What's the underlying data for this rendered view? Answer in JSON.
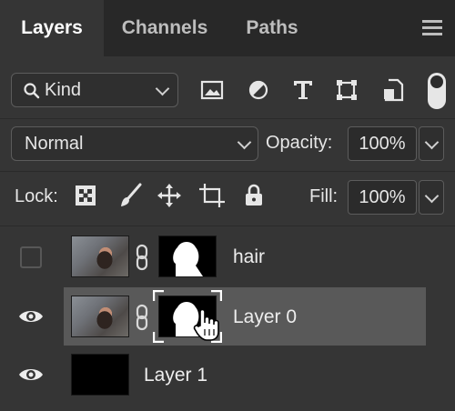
{
  "tabs": [
    {
      "label": "Layers",
      "active": true
    },
    {
      "label": "Channels",
      "active": false
    },
    {
      "label": "Paths",
      "active": false
    }
  ],
  "filter": {
    "kind_label": "Kind",
    "icons": [
      "image-filter-icon",
      "adjustment-filter-icon",
      "type-filter-icon",
      "shape-filter-icon",
      "smart-object-filter-icon"
    ]
  },
  "blend": {
    "mode": "Normal",
    "opacity_label": "Opacity:",
    "opacity_value": "100%"
  },
  "lock": {
    "label": "Lock:",
    "icons": [
      "lock-transparent-pixels-icon",
      "lock-image-pixels-icon",
      "lock-position-icon",
      "lock-artboard-icon",
      "lock-all-icon"
    ],
    "fill_label": "Fill:",
    "fill_value": "100%"
  },
  "layers": [
    {
      "name": "hair",
      "visible": false,
      "selected": false,
      "has_mask": true
    },
    {
      "name": "Layer 0",
      "visible": true,
      "selected": true,
      "has_mask": true
    },
    {
      "name": "Layer 1",
      "visible": true,
      "selected": false,
      "has_mask": false
    }
  ],
  "colors": {
    "panel_bg": "#353535",
    "tab_bg": "#282828",
    "selected_row": "#595959",
    "text": "#e6e6e6"
  }
}
